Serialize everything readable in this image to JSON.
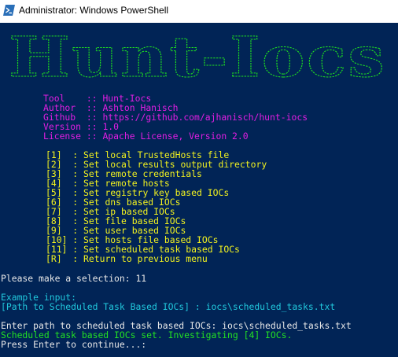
{
  "window": {
    "title": "Administrator: Windows PowerShell",
    "icon": "powershell-icon"
  },
  "colors": {
    "background": "#012456",
    "banner": "#1fe31f",
    "magenta": "#e21ee2",
    "yellow": "#f2f21f",
    "white": "#e8e8e8",
    "cyan": "#21c8dd",
    "green": "#23e123"
  },
  "banner": {
    "text": "Hunt-Iocs"
  },
  "info": [
    {
      "key": "Tool    ",
      "sep": ":: ",
      "value": "Hunt-Iocs"
    },
    {
      "key": "Author  ",
      "sep": ":: ",
      "value": "Ashton Hanisch"
    },
    {
      "key": "Github  ",
      "sep": ":: ",
      "value": "https://github.com/ajhanisch/hunt-iocs"
    },
    {
      "key": "Version ",
      "sep": ":: ",
      "value": "1.0"
    },
    {
      "key": "License ",
      "sep": ":: ",
      "value": "Apache License, Version 2.0"
    }
  ],
  "menu": [
    {
      "num": "[1]  ",
      "text": ": Set local TrustedHosts file"
    },
    {
      "num": "[2]  ",
      "text": ": Set local results output directory"
    },
    {
      "num": "[3]  ",
      "text": ": Set remote credentials"
    },
    {
      "num": "[4]  ",
      "text": ": Set remote hosts"
    },
    {
      "num": "[5]  ",
      "text": ": Set registry key based IOCs"
    },
    {
      "num": "[6]  ",
      "text": ": Set dns based IOCs"
    },
    {
      "num": "[7]  ",
      "text": ": Set ip based IOCs"
    },
    {
      "num": "[8]  ",
      "text": ": Set file based IOCs"
    },
    {
      "num": "[9]  ",
      "text": ": Set user based IOCs"
    },
    {
      "num": "[10] ",
      "text": ": Set hosts file based IOCs"
    },
    {
      "num": "[11] ",
      "text": ": Set scheduled task based IOCs"
    },
    {
      "num": "[R]  ",
      "text": ": Return to previous menu"
    }
  ],
  "prompt": {
    "selection_label": "Please make a selection: ",
    "selection_value": "11"
  },
  "example": {
    "label": "Example input:",
    "text": "[Path to Scheduled Task Based IOCs] : iocs\\scheduled_tasks.txt"
  },
  "output": {
    "enter_path": "Enter path to scheduled task based IOCs: iocs\\scheduled_tasks.txt",
    "confirmation": "Scheduled task based IOCs set. Investigating [4] IOCs.",
    "continue": "Press Enter to continue...:"
  }
}
